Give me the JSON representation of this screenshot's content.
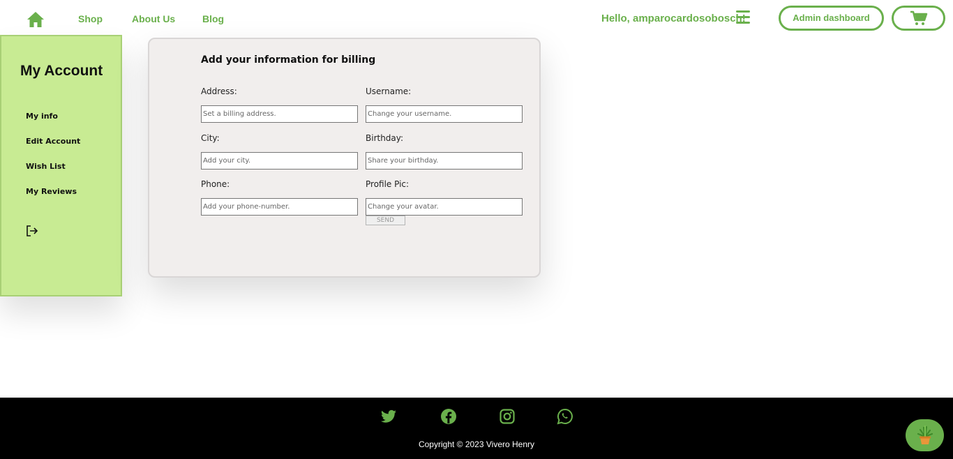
{
  "nav": {
    "links": [
      "Shop",
      "About Us",
      "Blog"
    ],
    "greeting": "Hello, amparocardosobosch!",
    "admin_label": "Admin dashboard"
  },
  "sidebar": {
    "title": "My Account",
    "items": [
      {
        "label": "My info"
      },
      {
        "label": "Edit Account"
      },
      {
        "label": "Wish List"
      },
      {
        "label": "My Reviews"
      }
    ]
  },
  "form": {
    "title": "Add your information for billing",
    "fields": [
      {
        "label": "Address:",
        "placeholder": "Set a billing address.",
        "value": ""
      },
      {
        "label": "Username:",
        "placeholder": "Change your username.",
        "value": ""
      },
      {
        "label": "City:",
        "placeholder": "Add your city.",
        "value": ""
      },
      {
        "label": "Birthday:",
        "placeholder": "Share your birthday.",
        "value": ""
      },
      {
        "label": "Phone:",
        "placeholder": "Add your phone-number.",
        "value": ""
      },
      {
        "label": "Profile Pic:",
        "placeholder": "Change your avatar.",
        "value": ""
      }
    ],
    "send_label": "SEND"
  },
  "footer": {
    "social_icons": [
      "twitter-icon",
      "facebook-icon",
      "instagram-icon",
      "whatsapp-icon"
    ],
    "copyright": "Copyright © 2023 Vivero Henry"
  },
  "colors": {
    "brand_green": "#6ab04c",
    "sidebar_bg": "#c8eb93",
    "card_bg": "#f1eeed",
    "footer_bg": "#000000"
  }
}
